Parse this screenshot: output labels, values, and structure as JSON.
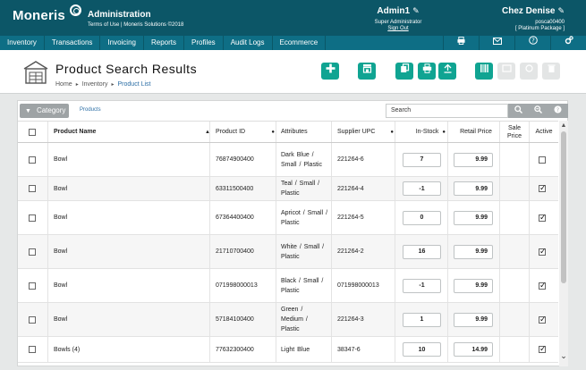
{
  "header": {
    "logo": "Moneris",
    "app_title": "Administration",
    "app_sub": "Terms of Use | Moneris Solutions ©2018",
    "user_name": "Admin1",
    "user_role": "Super Administrator",
    "sign_out": "Sign Out",
    "store_name": "Chez Denise",
    "store_id": "posca00400",
    "store_package": "[ Platinum Package ]"
  },
  "nav": {
    "items": [
      "Inventory",
      "Transactions",
      "Invoicing",
      "Reports",
      "Profiles",
      "Audit Logs",
      "Ecommerce"
    ],
    "icons": [
      "printer-icon",
      "mail-icon",
      "help-icon",
      "settings-icon"
    ]
  },
  "page": {
    "title": "Product Search Results",
    "breadcrumb": [
      "Home",
      "Inventory",
      "Product List"
    ],
    "toolbar": [
      "add-icon",
      "store-icon",
      "copy-icon",
      "print-icon",
      "export-icon",
      "barcode-icon",
      "disabled-1",
      "disabled-2",
      "disabled-3"
    ]
  },
  "filters": {
    "category_label": "Category",
    "products_link": "Products",
    "search_placeholder": "Search"
  },
  "table": {
    "headers": {
      "name": "Product Name",
      "id": "Product ID",
      "attributes": "Attributes",
      "upc": "Supplier UPC",
      "stock": "In-Stock",
      "retail": "Retail Price",
      "sale": "Sale Price",
      "active": "Active"
    },
    "rows": [
      {
        "name": "Bowl",
        "id": "76874900400",
        "attributes": "Dark Blue / Small / Plastic",
        "upc": "221264-6",
        "stock": "7",
        "retail": "9.99",
        "active": false
      },
      {
        "name": "Bowl",
        "id": "63311500400",
        "attributes": "Teal / Small / Plastic",
        "upc": "221264-4",
        "stock": "-1",
        "retail": "9.99",
        "active": true
      },
      {
        "name": "Bowl",
        "id": "67364400400",
        "attributes": "Apricot / Small / Plastic",
        "upc": "221264-5",
        "stock": "0",
        "retail": "9.99",
        "active": true
      },
      {
        "name": "Bowl",
        "id": "21710700400",
        "attributes": "White / Small / Plastic",
        "upc": "221264-2",
        "stock": "16",
        "retail": "9.99",
        "active": true
      },
      {
        "name": "Bowl",
        "id": "071998000013",
        "attributes": "Black / Small / Plastic",
        "upc": "071998000013",
        "stock": "-1",
        "retail": "9.99",
        "active": true
      },
      {
        "name": "Bowl",
        "id": "57184100400",
        "attributes": "Green / Medium / Plastic",
        "upc": "221264-3",
        "stock": "1",
        "retail": "9.99",
        "active": true
      },
      {
        "name": "Bowls (4)",
        "id": "77632300400",
        "attributes": "Light Blue",
        "upc": "38347-6",
        "stock": "10",
        "retail": "14.99",
        "active": true
      }
    ]
  },
  "colors": {
    "header_bg": "#0c5667",
    "nav_bg": "#0e6e85",
    "accent": "#10a492",
    "link": "#2b6ea5"
  }
}
